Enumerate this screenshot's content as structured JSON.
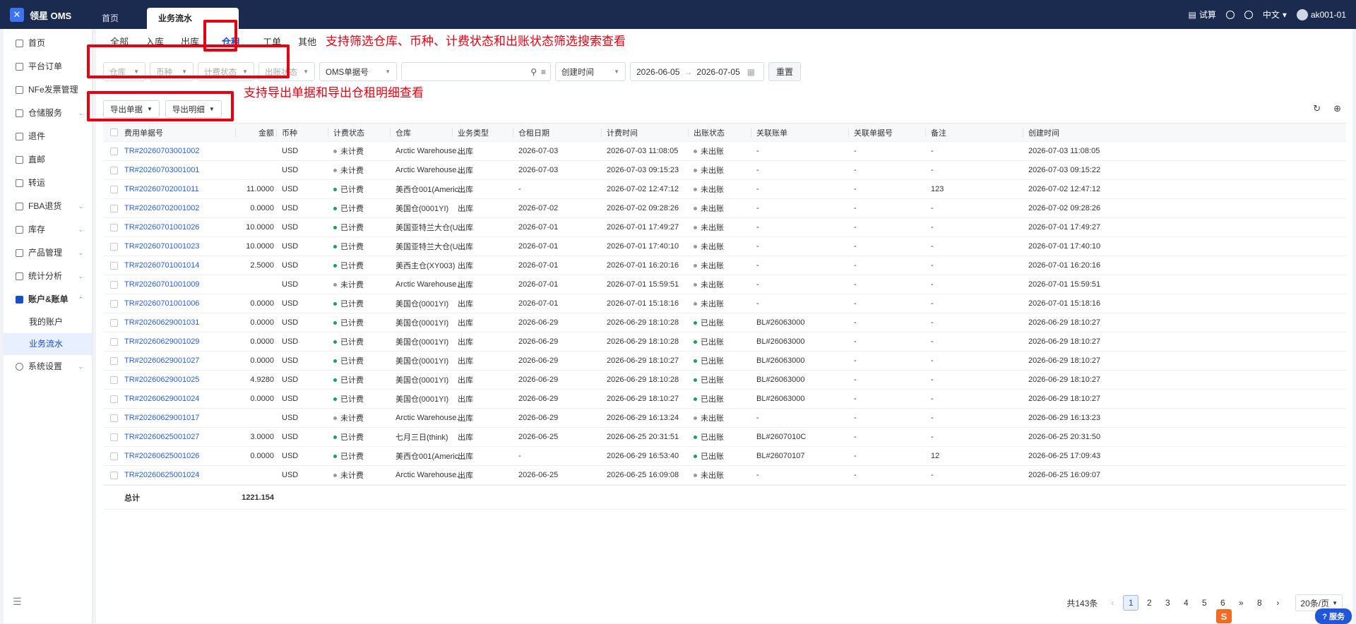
{
  "app": {
    "name": "领星 OMS",
    "logo_glyph": "✕"
  },
  "top_tabs": [
    "首页",
    "业务流水"
  ],
  "top_right": {
    "calc": "试算",
    "lang": "中文",
    "user": "ak001-01"
  },
  "sidebar": {
    "items": [
      {
        "label": "首页",
        "chev": ""
      },
      {
        "label": "平台订单",
        "chev": ""
      },
      {
        "label": "NFe发票管理",
        "chev": ""
      },
      {
        "label": "仓储服务",
        "chev": "⌄"
      },
      {
        "label": "退件",
        "chev": ""
      },
      {
        "label": "直邮",
        "chev": ""
      },
      {
        "label": "转运",
        "chev": ""
      },
      {
        "label": "FBA退货",
        "chev": "⌄"
      },
      {
        "label": "库存",
        "chev": "⌄"
      },
      {
        "label": "产品管理",
        "chev": "⌄"
      },
      {
        "label": "统计分析",
        "chev": "⌄"
      },
      {
        "label": "账户&账单",
        "chev": "⌃"
      }
    ],
    "sub": [
      "我的账户",
      "业务流水"
    ],
    "last": {
      "label": "系统设置",
      "chev": "⌄"
    }
  },
  "sub_tabs": [
    "全部",
    "入库",
    "出库",
    "仓租",
    "工单",
    "其他"
  ],
  "annotations": {
    "a1": "支持筛选仓库、币种、计费状态和出账状态筛选搜索查看",
    "a2": "支持导出单据和导出仓租明细查看"
  },
  "filters": {
    "warehouse": "仓库",
    "currency": "币种",
    "billing": "计费状态",
    "account": "出账状态",
    "doc_type": "OMS单据号",
    "time_type": "创建时间",
    "date_from": "2026-06-05",
    "date_arrow": "→",
    "date_to": "2026-07-05",
    "reset": "重置"
  },
  "actions": {
    "export_doc": "导出单据",
    "export_detail": "导出明细"
  },
  "columns": [
    "费用单据号",
    "金额",
    "币种",
    "计费状态",
    "仓库",
    "业务类型",
    "仓租日期",
    "计费时间",
    "出账状态",
    "关联账单",
    "关联单据号",
    "备注",
    "创建时间"
  ],
  "rows": [
    {
      "id": "TR#20260703001002",
      "amount": "",
      "cur": "USD",
      "bill": "未计费",
      "wh": "Arctic Warehouse...",
      "type": "出库",
      "rent": "2026-07-03",
      "btime": "2026-07-03 11:08:05",
      "acct": "未出账",
      "rel": "-",
      "reldoc": "-",
      "note": "-",
      "ctime": "2026-07-03 11:08:05"
    },
    {
      "id": "TR#20260703001001",
      "amount": "",
      "cur": "USD",
      "bill": "未计费",
      "wh": "Arctic Warehouse...",
      "type": "出库",
      "rent": "2026-07-03",
      "btime": "2026-07-03 09:15:23",
      "acct": "未出账",
      "rel": "-",
      "reldoc": "-",
      "note": "-",
      "ctime": "2026-07-03 09:15:22"
    },
    {
      "id": "TR#20260702001011",
      "amount": "11.0000",
      "cur": "USD",
      "bill": "已计费",
      "wh": "美西仓001(Americ...",
      "type": "出库",
      "rent": "-",
      "btime": "2026-07-02 12:47:12",
      "acct": "未出账",
      "rel": "-",
      "reldoc": "-",
      "note": "123",
      "ctime": "2026-07-02 12:47:12"
    },
    {
      "id": "TR#20260702001002",
      "amount": "0.0000",
      "cur": "USD",
      "bill": "已计费",
      "wh": "美国仓(0001YI)",
      "type": "出库",
      "rent": "2026-07-02",
      "btime": "2026-07-02 09:28:26",
      "acct": "未出账",
      "rel": "-",
      "reldoc": "-",
      "note": "-",
      "ctime": "2026-07-02 09:28:26"
    },
    {
      "id": "TR#20260701001026",
      "amount": "10.0000",
      "cur": "USD",
      "bill": "已计费",
      "wh": "美国亚特兰大仓(U...",
      "type": "出库",
      "rent": "2026-07-01",
      "btime": "2026-07-01 17:49:27",
      "acct": "未出账",
      "rel": "-",
      "reldoc": "-",
      "note": "-",
      "ctime": "2026-07-01 17:49:27"
    },
    {
      "id": "TR#20260701001023",
      "amount": "10.0000",
      "cur": "USD",
      "bill": "已计费",
      "wh": "美国亚特兰大仓(U...",
      "type": "出库",
      "rent": "2026-07-01",
      "btime": "2026-07-01 17:40:10",
      "acct": "未出账",
      "rel": "-",
      "reldoc": "-",
      "note": "-",
      "ctime": "2026-07-01 17:40:10"
    },
    {
      "id": "TR#20260701001014",
      "amount": "2.5000",
      "cur": "USD",
      "bill": "已计费",
      "wh": "美西主仓(XY003)",
      "type": "出库",
      "rent": "2026-07-01",
      "btime": "2026-07-01 16:20:16",
      "acct": "未出账",
      "rel": "-",
      "reldoc": "-",
      "note": "-",
      "ctime": "2026-07-01 16:20:16"
    },
    {
      "id": "TR#20260701001009",
      "amount": "",
      "cur": "USD",
      "bill": "未计费",
      "wh": "Arctic Warehouse...",
      "type": "出库",
      "rent": "2026-07-01",
      "btime": "2026-07-01 15:59:51",
      "acct": "未出账",
      "rel": "-",
      "reldoc": "-",
      "note": "-",
      "ctime": "2026-07-01 15:59:51"
    },
    {
      "id": "TR#20260701001006",
      "amount": "0.0000",
      "cur": "USD",
      "bill": "已计费",
      "wh": "美国仓(0001YI)",
      "type": "出库",
      "rent": "2026-07-01",
      "btime": "2026-07-01 15:18:16",
      "acct": "未出账",
      "rel": "-",
      "reldoc": "-",
      "note": "-",
      "ctime": "2026-07-01 15:18:16"
    },
    {
      "id": "TR#20260629001031",
      "amount": "0.0000",
      "cur": "USD",
      "bill": "已计费",
      "wh": "美国仓(0001YI)",
      "type": "出库",
      "rent": "2026-06-29",
      "btime": "2026-06-29 18:10:28",
      "acct": "已出账",
      "rel": "BL#26063000",
      "reldoc": "-",
      "note": "-",
      "ctime": "2026-06-29 18:10:27"
    },
    {
      "id": "TR#20260629001029",
      "amount": "0.0000",
      "cur": "USD",
      "bill": "已计费",
      "wh": "美国仓(0001YI)",
      "type": "出库",
      "rent": "2026-06-29",
      "btime": "2026-06-29 18:10:28",
      "acct": "已出账",
      "rel": "BL#26063000",
      "reldoc": "-",
      "note": "-",
      "ctime": "2026-06-29 18:10:27"
    },
    {
      "id": "TR#20260629001027",
      "amount": "0.0000",
      "cur": "USD",
      "bill": "已计费",
      "wh": "美国仓(0001YI)",
      "type": "出库",
      "rent": "2026-06-29",
      "btime": "2026-06-29 18:10:27",
      "acct": "已出账",
      "rel": "BL#26063000",
      "reldoc": "-",
      "note": "-",
      "ctime": "2026-06-29 18:10:27"
    },
    {
      "id": "TR#20260629001025",
      "amount": "4.9280",
      "cur": "USD",
      "bill": "已计费",
      "wh": "美国仓(0001YI)",
      "type": "出库",
      "rent": "2026-06-29",
      "btime": "2026-06-29 18:10:28",
      "acct": "已出账",
      "rel": "BL#26063000",
      "reldoc": "-",
      "note": "-",
      "ctime": "2026-06-29 18:10:27"
    },
    {
      "id": "TR#20260629001024",
      "amount": "0.0000",
      "cur": "USD",
      "bill": "已计费",
      "wh": "美国仓(0001YI)",
      "type": "出库",
      "rent": "2026-06-29",
      "btime": "2026-06-29 18:10:27",
      "acct": "已出账",
      "rel": "BL#26063000",
      "reldoc": "-",
      "note": "-",
      "ctime": "2026-06-29 18:10:27"
    },
    {
      "id": "TR#20260629001017",
      "amount": "",
      "cur": "USD",
      "bill": "未计费",
      "wh": "Arctic Warehouse...",
      "type": "出库",
      "rent": "2026-06-29",
      "btime": "2026-06-29 16:13:24",
      "acct": "未出账",
      "rel": "-",
      "reldoc": "-",
      "note": "-",
      "ctime": "2026-06-29 16:13:23"
    },
    {
      "id": "TR#20260625001027",
      "amount": "3.0000",
      "cur": "USD",
      "bill": "已计费",
      "wh": "七月三日(think)",
      "type": "出库",
      "rent": "2026-06-25",
      "btime": "2026-06-25 20:31:51",
      "acct": "已出账",
      "rel": "BL#2607010C",
      "reldoc": "-",
      "note": "-",
      "ctime": "2026-06-25 20:31:50"
    },
    {
      "id": "TR#20260625001026",
      "amount": "0.0000",
      "cur": "USD",
      "bill": "已计费",
      "wh": "美西仓001(Americ...",
      "type": "出库",
      "rent": "-",
      "btime": "2026-06-29 16:53:40",
      "acct": "已出账",
      "rel": "BL#26070107",
      "reldoc": "-",
      "note": "12",
      "ctime": "2026-06-25 17:09:43"
    },
    {
      "id": "TR#20260625001024",
      "amount": "",
      "cur": "USD",
      "bill": "未计费",
      "wh": "Arctic Warehouse...",
      "type": "出库",
      "rent": "2026-06-25",
      "btime": "2026-06-25 16:09:08",
      "acct": "未出账",
      "rel": "-",
      "reldoc": "-",
      "note": "-",
      "ctime": "2026-06-25 16:09:07"
    }
  ],
  "total": {
    "label": "总计",
    "amount": "1221.154"
  },
  "pager": {
    "total": "共143条",
    "prev": "‹",
    "pages": [
      "1",
      "2",
      "3",
      "4",
      "5",
      "6"
    ],
    "more": "»",
    "last": "8",
    "next": "›",
    "size": "20条/页"
  },
  "colors": {
    "billed": "#1aa05a",
    "unbilled": "#999999",
    "posted": "#1aa05a",
    "accent": "#1a4ec9",
    "annot": "#e60012"
  },
  "misc": {
    "service": "服务",
    "sogou": "S"
  }
}
